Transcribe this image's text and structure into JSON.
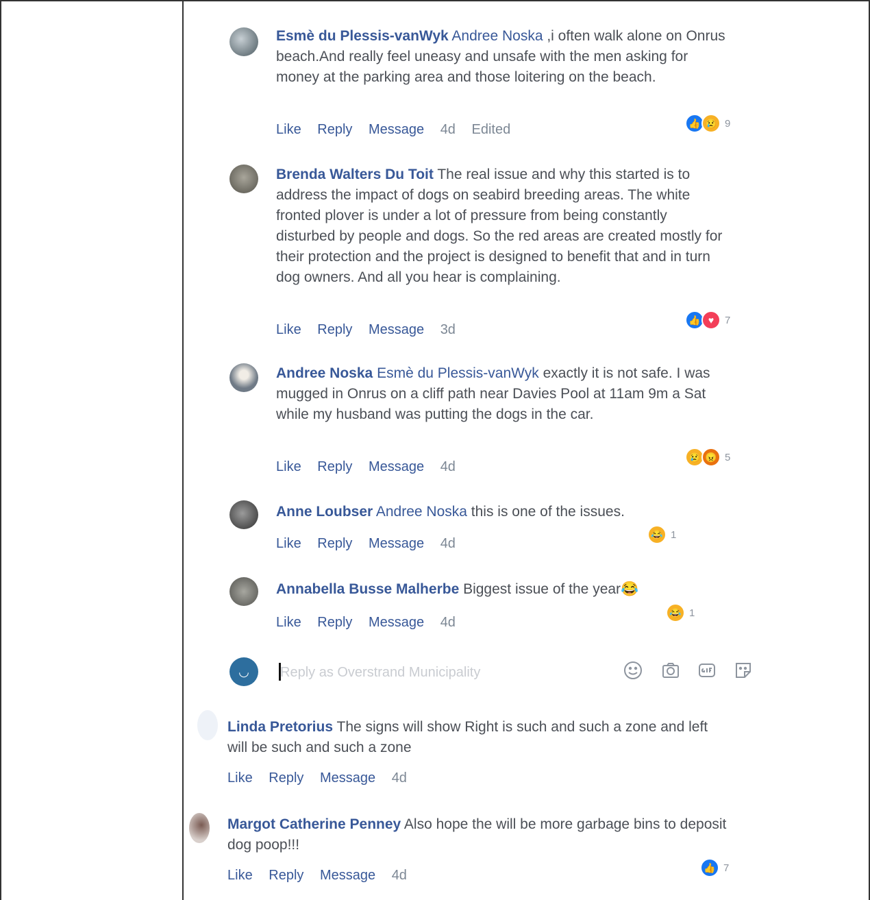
{
  "comments": [
    {
      "author": "Esmè du Plessis-vanWyk",
      "mention": "Andree Noska",
      "text": " ,i often walk alone on Onrus beach.And really feel uneasy and unsafe with the men asking for money at the parking area and those loitering on the beach.",
      "actions": {
        "like": "Like",
        "reply": "Reply",
        "message": "Message",
        "time": "4d",
        "edited": "Edited"
      },
      "reactions": {
        "icons": [
          "like-icon",
          "sad-icon"
        ],
        "count": "9"
      }
    },
    {
      "author": "Brenda Walters Du Toit",
      "text": " The real issue and why this started is to address the impact of dogs on seabird breeding areas. The white fronted plover is under a lot of pressure from being constantly disturbed by people and dogs. So the red areas are created mostly for their protection and the project is designed to benefit that and in turn dog owners. And all you hear is complaining.",
      "actions": {
        "like": "Like",
        "reply": "Reply",
        "message": "Message",
        "time": "3d"
      },
      "reactions": {
        "icons": [
          "like-icon",
          "love-icon"
        ],
        "count": "7"
      }
    },
    {
      "author": "Andree Noska",
      "mention": "Esmè du Plessis-vanWyk",
      "text": " exactly it is not safe. I was mugged in Onrus on a cliff path near Davies Pool at 11am 9m a Sat while my husband was putting the dogs in the car.",
      "actions": {
        "like": "Like",
        "reply": "Reply",
        "message": "Message",
        "time": "4d"
      },
      "reactions": {
        "icons": [
          "sad-icon",
          "angry-icon"
        ],
        "count": "5"
      }
    },
    {
      "author": "Anne Loubser",
      "mention": "Andree Noska",
      "text": " this is one of the issues.",
      "actions": {
        "like": "Like",
        "reply": "Reply",
        "message": "Message",
        "time": "4d"
      },
      "reactions": {
        "icons": [
          "haha-icon"
        ],
        "count": "1"
      }
    },
    {
      "author": "Annabella Busse Malherbe",
      "text": " Biggest issue of the year😂",
      "actions": {
        "like": "Like",
        "reply": "Reply",
        "message": "Message",
        "time": "4d"
      },
      "reactions": {
        "icons": [
          "haha-icon"
        ],
        "count": "1"
      }
    }
  ],
  "reply_box": {
    "placeholder": "Reply as Overstrand Municipality",
    "tools": [
      "emoji-icon",
      "camera-icon",
      "gif-icon",
      "sticker-icon"
    ]
  },
  "top_comments": [
    {
      "author": "Linda Pretorius",
      "text": " The signs will show Right is such and such a zone and left will be such and such a zone",
      "actions": {
        "like": "Like",
        "reply": "Reply",
        "message": "Message",
        "time": "4d"
      }
    },
    {
      "author": "Margot Catherine Penney",
      "text": " Also hope the will be more garbage bins to deposit dog poop!!!",
      "actions": {
        "like": "Like",
        "reply": "Reply",
        "message": "Message",
        "time": "4d"
      },
      "reactions": {
        "icons": [
          "like-icon"
        ],
        "count": "7"
      }
    }
  ],
  "colors": {
    "link": "#385898",
    "text": "#4b4f56",
    "meta": "#7c8794",
    "like": "#1877f2"
  }
}
